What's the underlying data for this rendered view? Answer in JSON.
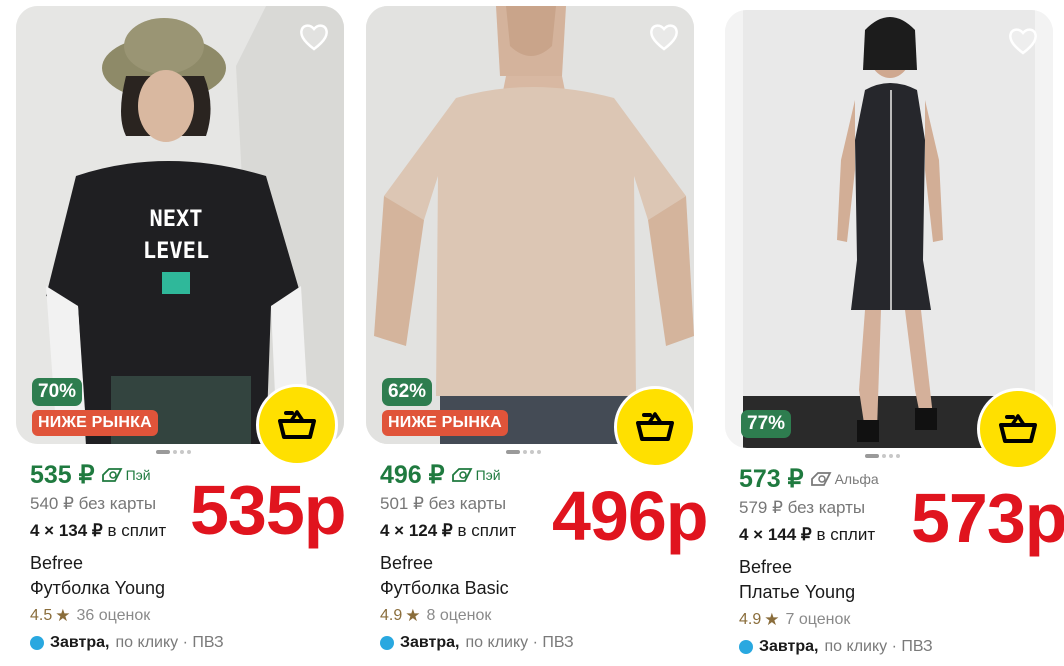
{
  "products": [
    {
      "discount": "70%",
      "below_market": "НИЖЕ РЫНКА",
      "price": "535 ₽",
      "pay_method": "Пэй",
      "old_price": "540 ₽ без карты",
      "split_count": "4 × 134 ₽",
      "split_label": "в сплит",
      "brand": "Befree",
      "name": "Футболка Young",
      "rating": "4.5",
      "reviews": "36 оценок",
      "delivery_day": "Завтра,",
      "delivery_rest": "по клику · ПВЗ",
      "overlay_price": "535р",
      "shirt_text_1": "NEXT",
      "shirt_text_2": "LEVEL"
    },
    {
      "discount": "62%",
      "below_market": "НИЖЕ РЫНКА",
      "price": "496 ₽",
      "pay_method": "Пэй",
      "old_price": "501 ₽ без карты",
      "split_count": "4 × 124 ₽",
      "split_label": "в сплит",
      "brand": "Befree",
      "name": "Футболка Basic",
      "rating": "4.9",
      "reviews": "8 оценок",
      "delivery_day": "Завтра,",
      "delivery_rest": "по клику · ПВЗ",
      "overlay_price": "496р"
    },
    {
      "discount": "77%",
      "price": "573 ₽",
      "pay_method": "Альфа",
      "old_price": "579 ₽ без карты",
      "split_count": "4 × 144 ₽",
      "split_label": "в сплит",
      "brand": "Befree",
      "name": "Платье Young",
      "rating": "4.9",
      "reviews": "7 оценок",
      "delivery_day": "Завтра,",
      "delivery_rest": "по клику · ПВЗ",
      "overlay_price": "573р"
    }
  ],
  "icons": {
    "favorite": "heart-outline-icon",
    "cart": "basket-icon",
    "rating": "star-icon",
    "payment": "card-pay-icon"
  },
  "colors": {
    "price_green": "#1f7a3f",
    "discount_green": "#2e7d4f",
    "below_market_red": "#e0543a",
    "cart_yellow": "#ffe000",
    "overlay_red": "#e0141e",
    "delivery_blue": "#29a8e0"
  }
}
